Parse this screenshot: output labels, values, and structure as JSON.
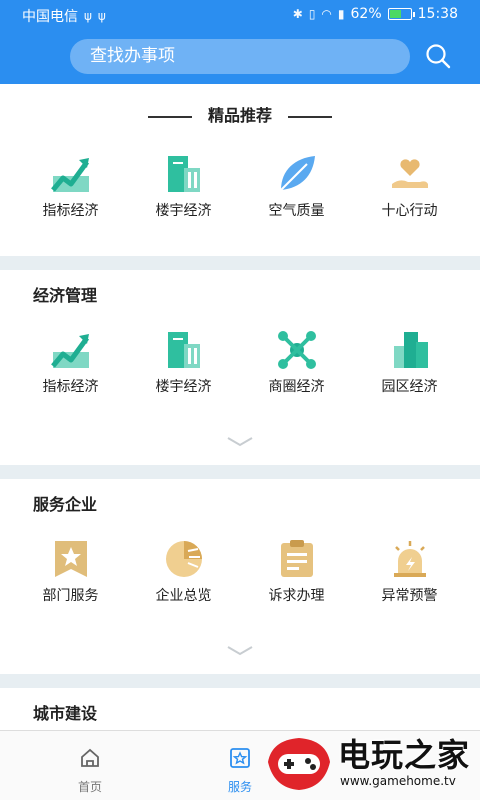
{
  "status_bar": {
    "carrier": "中国电信",
    "battery_percent": "62%",
    "battery_level": 0.62,
    "time": "15:38"
  },
  "search": {
    "placeholder": "查找办事项"
  },
  "featured": {
    "title": "精品推荐",
    "items": [
      {
        "label": "指标经济",
        "icon": "chart-trend-icon"
      },
      {
        "label": "楼宇经济",
        "icon": "building-icon"
      },
      {
        "label": "空气质量",
        "icon": "leaf-icon"
      },
      {
        "label": "十心行动",
        "icon": "heart-hand-icon"
      }
    ]
  },
  "economy": {
    "title": "经济管理",
    "items": [
      {
        "label": "指标经济",
        "icon": "chart-trend-icon"
      },
      {
        "label": "楼宇经济",
        "icon": "building-icon"
      },
      {
        "label": "商圈经济",
        "icon": "network-icon"
      },
      {
        "label": "园区经济",
        "icon": "park-buildings-icon"
      }
    ]
  },
  "enterprise": {
    "title": "服务企业",
    "items": [
      {
        "label": "部门服务",
        "icon": "star-badge-icon"
      },
      {
        "label": "企业总览",
        "icon": "pie-chart-icon"
      },
      {
        "label": "诉求办理",
        "icon": "clipboard-icon"
      },
      {
        "label": "异常预警",
        "icon": "alarm-light-icon"
      }
    ]
  },
  "city": {
    "title": "城市建设"
  },
  "nav": {
    "home": "首页",
    "service": "服务"
  },
  "watermark": {
    "name": "电玩之家",
    "url": "www.gamehome.tv"
  },
  "colors": {
    "header_blue": "#2b8ef0",
    "teal": "#28b8a0",
    "gold": "#d9b46a"
  }
}
